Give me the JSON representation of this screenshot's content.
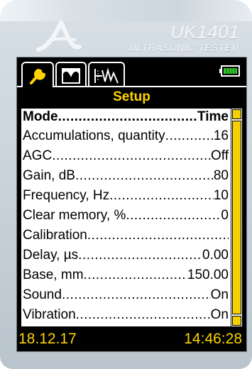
{
  "brand": {
    "model": "UK1401",
    "subtitle": "ULTRASONIC TESTER"
  },
  "tabs": [
    {
      "name": "wrench-icon",
      "active": true
    },
    {
      "name": "profile-icon",
      "active": false
    },
    {
      "name": "signal-icon",
      "active": false
    }
  ],
  "battery": {
    "icon": "battery-icon",
    "color": "#36c92b"
  },
  "screen": {
    "title": "Setup",
    "items": [
      {
        "label": "Mode",
        "value": "Time"
      },
      {
        "label": "Accumulations, quantity",
        "value": "16"
      },
      {
        "label": "AGC",
        "value": "Off"
      },
      {
        "label": "Gain, dB",
        "value": "80"
      },
      {
        "label": "Frequency, Hz",
        "value": "10"
      },
      {
        "label": "Clear memory, %",
        "value": "0"
      },
      {
        "label": "Calibration",
        "value": ""
      },
      {
        "label": "Delay, µs",
        "value": "0.00"
      },
      {
        "label": "Base, mm",
        "value": "150.00"
      },
      {
        "label": "Sound",
        "value": "On"
      },
      {
        "label": "Vibration",
        "value": "On"
      }
    ]
  },
  "status": {
    "date": "18.12.17",
    "time": "14:46:28"
  },
  "colors": {
    "accent": "#ffd400",
    "screen_bg": "#000000",
    "body": "#c7d1d9"
  }
}
